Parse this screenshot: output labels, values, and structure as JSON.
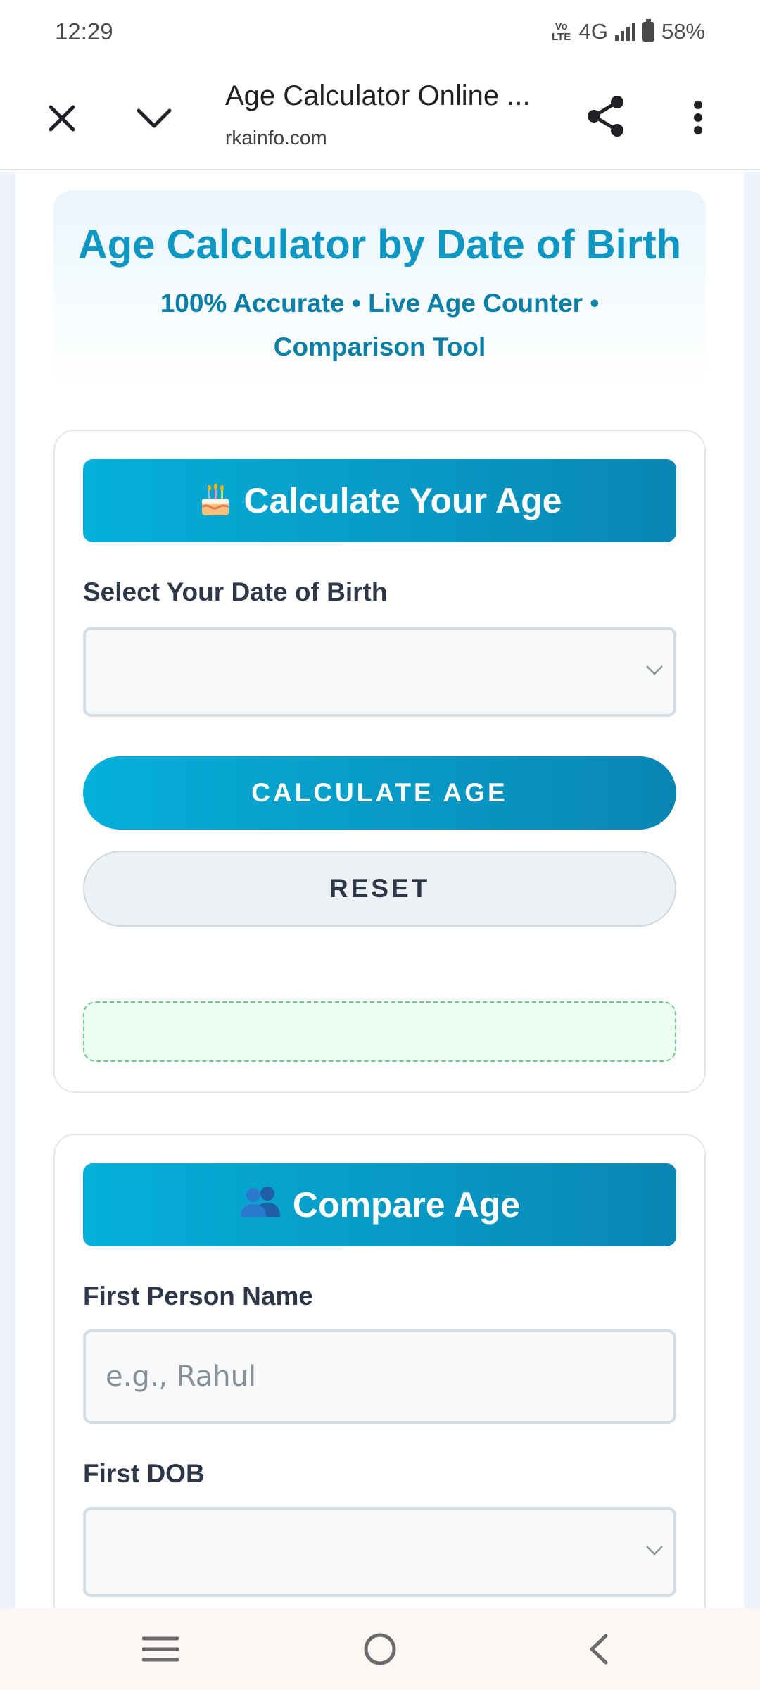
{
  "status_bar": {
    "time": "12:29",
    "volte": "VoLTE",
    "network": "4G",
    "battery": "58%"
  },
  "browser": {
    "title": "Age Calculator Online ...",
    "url": "rkainfo.com",
    "icons": [
      "close-icon",
      "chevron-down-icon",
      "share-icon",
      "more-vert-icon"
    ]
  },
  "hero": {
    "title": "Age Calculator by Date of Birth",
    "subtitle": "100% Accurate • Live Age Counter • Comparison Tool"
  },
  "calculator": {
    "header": "Calculate Your Age",
    "header_icon": "birthday-cake-icon",
    "dob_label": "Select Your Date of Birth",
    "dob_value": "",
    "calculate_label": "CALCULATE AGE",
    "reset_label": "RESET",
    "result": ""
  },
  "compare": {
    "header": "Compare Age",
    "header_icon": "people-icon",
    "first_name_label": "First Person Name",
    "first_name_placeholder": "e.g., Rahul",
    "first_name_value": "",
    "first_dob_label": "First DOB",
    "first_dob_value": ""
  },
  "nav": {
    "icons": [
      "recent-apps-icon",
      "home-icon",
      "back-icon"
    ]
  },
  "colors": {
    "accent": "#0e97c3",
    "header_gradient_start": "#05b0da",
    "header_gradient_end": "#0a86b3",
    "result_bg": "#edfdf1",
    "result_border": "#6cc98a"
  }
}
